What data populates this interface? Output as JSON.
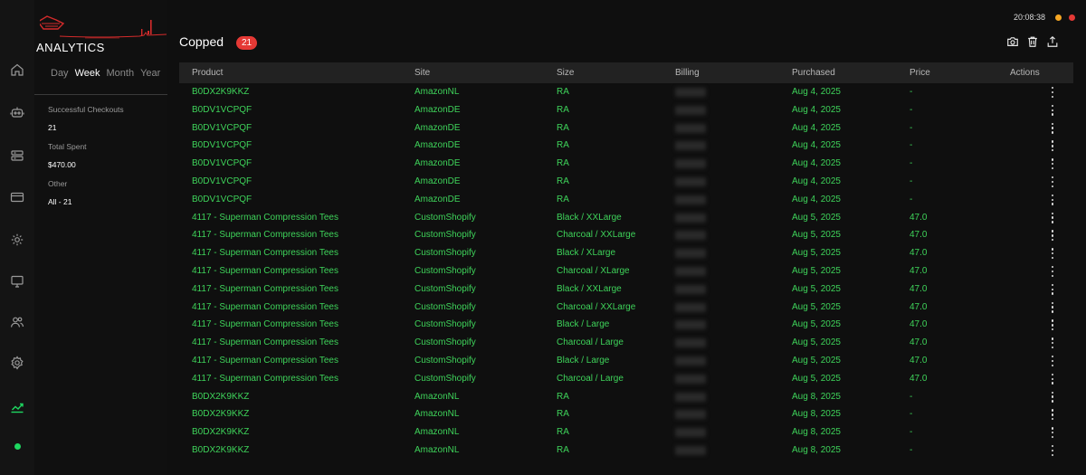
{
  "window": {
    "clock": "20:08:38",
    "dot_colors": [
      "#f5a623",
      "#e53935"
    ]
  },
  "rail": {
    "items": [
      {
        "icon": "home-icon",
        "active": false
      },
      {
        "icon": "bot-icon",
        "active": false
      },
      {
        "icon": "server-icon",
        "active": false
      },
      {
        "icon": "card-icon",
        "active": false
      },
      {
        "icon": "gear-cycle-icon",
        "active": false
      },
      {
        "icon": "monitor-icon",
        "active": false
      },
      {
        "icon": "users-icon",
        "active": false
      },
      {
        "icon": "settings-icon",
        "active": false
      },
      {
        "icon": "analytics-icon",
        "active": true
      }
    ],
    "status_color": "#1ed760",
    "accent_color": "#1ed760"
  },
  "panel": {
    "title": "ANALYTICS",
    "ranges": [
      "Day",
      "Week",
      "Month",
      "Year"
    ],
    "active_range": "Week",
    "stats": {
      "checkouts_label": "Successful Checkouts",
      "checkouts_value": "21",
      "spent_label": "Total Spent",
      "spent_value": "$470.00",
      "other_label": "Other",
      "other_value": "All - 21"
    }
  },
  "main": {
    "title": "Copped",
    "count": "21",
    "count_color": "#e53935",
    "toolbar": [
      "camera-icon",
      "trash-icon",
      "export-icon"
    ],
    "columns": {
      "product": "Product",
      "site": "Site",
      "size": "Size",
      "billing": "Billing",
      "purchased": "Purchased",
      "price": "Price",
      "actions": "Actions"
    },
    "row_text_color": "#3ed35a",
    "rows": [
      {
        "product": "B0DX2K9KKZ",
        "site": "AmazonNL",
        "size": "RA",
        "purchased": "Aug 4, 2025",
        "price": "-"
      },
      {
        "product": "B0DV1VCPQF",
        "site": "AmazonDE",
        "size": "RA",
        "purchased": "Aug 4, 2025",
        "price": "-"
      },
      {
        "product": "B0DV1VCPQF",
        "site": "AmazonDE",
        "size": "RA",
        "purchased": "Aug 4, 2025",
        "price": "-"
      },
      {
        "product": "B0DV1VCPQF",
        "site": "AmazonDE",
        "size": "RA",
        "purchased": "Aug 4, 2025",
        "price": "-"
      },
      {
        "product": "B0DV1VCPQF",
        "site": "AmazonDE",
        "size": "RA",
        "purchased": "Aug 4, 2025",
        "price": "-"
      },
      {
        "product": "B0DV1VCPQF",
        "site": "AmazonDE",
        "size": "RA",
        "purchased": "Aug 4, 2025",
        "price": "-"
      },
      {
        "product": "B0DV1VCPQF",
        "site": "AmazonDE",
        "size": "RA",
        "purchased": "Aug 4, 2025",
        "price": "-"
      },
      {
        "product": "4117 - Superman Compression Tees",
        "site": "CustomShopify",
        "size": "Black / XXLarge",
        "purchased": "Aug 5, 2025",
        "price": "47.0"
      },
      {
        "product": "4117 - Superman Compression Tees",
        "site": "CustomShopify",
        "size": "Charcoal / XXLarge",
        "purchased": "Aug 5, 2025",
        "price": "47.0"
      },
      {
        "product": "4117 - Superman Compression Tees",
        "site": "CustomShopify",
        "size": "Black / XLarge",
        "purchased": "Aug 5, 2025",
        "price": "47.0"
      },
      {
        "product": "4117 - Superman Compression Tees",
        "site": "CustomShopify",
        "size": "Charcoal / XLarge",
        "purchased": "Aug 5, 2025",
        "price": "47.0"
      },
      {
        "product": "4117 - Superman Compression Tees",
        "site": "CustomShopify",
        "size": "Black / XXLarge",
        "purchased": "Aug 5, 2025",
        "price": "47.0"
      },
      {
        "product": "4117 - Superman Compression Tees",
        "site": "CustomShopify",
        "size": "Charcoal / XXLarge",
        "purchased": "Aug 5, 2025",
        "price": "47.0"
      },
      {
        "product": "4117 - Superman Compression Tees",
        "site": "CustomShopify",
        "size": "Black / Large",
        "purchased": "Aug 5, 2025",
        "price": "47.0"
      },
      {
        "product": "4117 - Superman Compression Tees",
        "site": "CustomShopify",
        "size": "Charcoal / Large",
        "purchased": "Aug 5, 2025",
        "price": "47.0"
      },
      {
        "product": "4117 - Superman Compression Tees",
        "site": "CustomShopify",
        "size": "Black / Large",
        "purchased": "Aug 5, 2025",
        "price": "47.0"
      },
      {
        "product": "4117 - Superman Compression Tees",
        "site": "CustomShopify",
        "size": "Charcoal / Large",
        "purchased": "Aug 5, 2025",
        "price": "47.0"
      },
      {
        "product": "B0DX2K9KKZ",
        "site": "AmazonNL",
        "size": "RA",
        "purchased": "Aug 8, 2025",
        "price": "-"
      },
      {
        "product": "B0DX2K9KKZ",
        "site": "AmazonNL",
        "size": "RA",
        "purchased": "Aug 8, 2025",
        "price": "-"
      },
      {
        "product": "B0DX2K9KKZ",
        "site": "AmazonNL",
        "size": "RA",
        "purchased": "Aug 8, 2025",
        "price": "-"
      },
      {
        "product": "B0DX2K9KKZ",
        "site": "AmazonNL",
        "size": "RA",
        "purchased": "Aug 8, 2025",
        "price": "-"
      }
    ]
  }
}
